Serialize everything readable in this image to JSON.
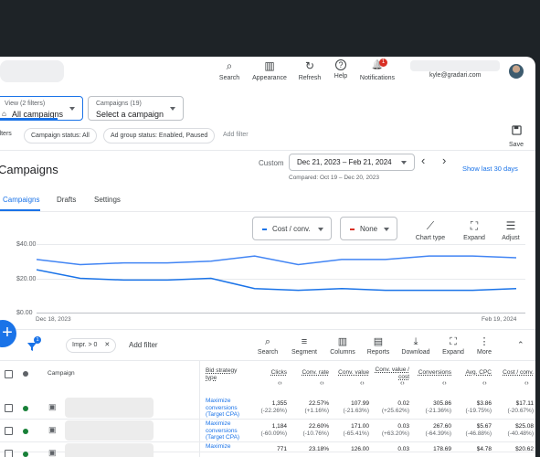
{
  "toolbar": {
    "buttons": [
      {
        "label": "Search",
        "icon": "search-icon"
      },
      {
        "label": "Appearance",
        "icon": "appearance-icon"
      },
      {
        "label": "Refresh",
        "icon": "refresh-icon"
      },
      {
        "label": "Help",
        "icon": "help-icon"
      },
      {
        "label": "Notifications",
        "icon": "bell-icon",
        "badge": "1"
      }
    ],
    "email": "kyle@gradari.com"
  },
  "filters": {
    "view_label": "View (2 filters)",
    "view_value": "All campaigns",
    "campaign_label": "Campaigns (19)",
    "campaign_value": "Select a campaign",
    "left_label": "ilters",
    "chips": [
      "Campaign status: All",
      "Ad group status: Enabled, Paused"
    ],
    "add_filter": "Add filter",
    "save": "Save"
  },
  "page": {
    "title": "Campaigns",
    "custom": "Custom",
    "date_range": "Dec 21, 2023 – Feb 21, 2024",
    "compared": "Compared: Oct 19 – Dec 20, 2023",
    "show_last": "Show last 30 days",
    "tabs": [
      "Campaigns",
      "Drafts",
      "Settings"
    ]
  },
  "chart_controls": {
    "metric1": "Cost / conv.",
    "metric2": "None",
    "chart_type": "Chart type",
    "expand": "Expand",
    "adjust": "Adjust",
    "metric1_color": "#1a73e8",
    "metric2_color": "#d93025"
  },
  "chart_data": {
    "type": "line",
    "y_ticks": [
      "$40.00",
      "$20.00",
      "$0.00"
    ],
    "ylim": [
      0,
      40
    ],
    "x_labels": [
      "Dec 18, 2023",
      "Feb 19, 2024"
    ],
    "series": [
      {
        "name": "Cost / conv.",
        "values": [
          25,
          20,
          19,
          19,
          20,
          14,
          13,
          14,
          13,
          13,
          13,
          14
        ],
        "color": "#1a73e8"
      },
      {
        "name": "",
        "values": [
          31,
          28,
          29,
          29,
          30,
          33,
          28,
          31,
          31,
          33,
          33,
          32
        ],
        "color": "#4285f4"
      }
    ]
  },
  "table_toolbar": {
    "filter_badge": "1",
    "impr_chip": "Impr. > 0",
    "add_filter": "Add filter",
    "tools": [
      {
        "label": "Search",
        "icon": "search-icon"
      },
      {
        "label": "Segment",
        "icon": "segment-icon"
      },
      {
        "label": "Columns",
        "icon": "columns-icon"
      },
      {
        "label": "Reports",
        "icon": "reports-icon"
      },
      {
        "label": "Download",
        "icon": "download-icon"
      },
      {
        "label": "Expand",
        "icon": "expand-icon"
      },
      {
        "label": "More",
        "icon": "more-icon"
      }
    ]
  },
  "table": {
    "headers": [
      "Campaign",
      "Bid strategy type",
      "Clicks",
      "Conv. rate",
      "Conv. value",
      "Conv. value / cost",
      "Conversions",
      "Avg. CPC",
      "Cost / conv."
    ],
    "rows": [
      {
        "bid": "Maximize conversions (Target CPA)",
        "cells": [
          [
            "1,355",
            "(-22.26%)"
          ],
          [
            "22.57%",
            "(+1.16%)"
          ],
          [
            "107.99",
            "(-21.63%)"
          ],
          [
            "0.02",
            "(+25.62%)"
          ],
          [
            "305.86",
            "(-21.36%)"
          ],
          [
            "$3.86",
            "(-19.75%)"
          ],
          [
            "$17.11",
            "(-20.67%)"
          ]
        ]
      },
      {
        "bid": "Maximize conversions (Target CPA)",
        "cells": [
          [
            "1,184",
            "(-60.09%)"
          ],
          [
            "22.60%",
            "(-10.76%)"
          ],
          [
            "171.00",
            "(-65.41%)"
          ],
          [
            "0.03",
            "(+63.20%)"
          ],
          [
            "267.60",
            "(-64.39%)"
          ],
          [
            "$5.67",
            "(-46.88%)"
          ],
          [
            "$25.08",
            "(-40.48%)"
          ]
        ]
      },
      {
        "bid": "Maximize",
        "cells": [
          [
            "771",
            ""
          ],
          [
            "23.18%",
            ""
          ],
          [
            "126.00",
            ""
          ],
          [
            "0.03",
            ""
          ],
          [
            "178.69",
            ""
          ],
          [
            "$4.78",
            ""
          ],
          [
            "$20.62",
            ""
          ]
        ]
      }
    ]
  }
}
